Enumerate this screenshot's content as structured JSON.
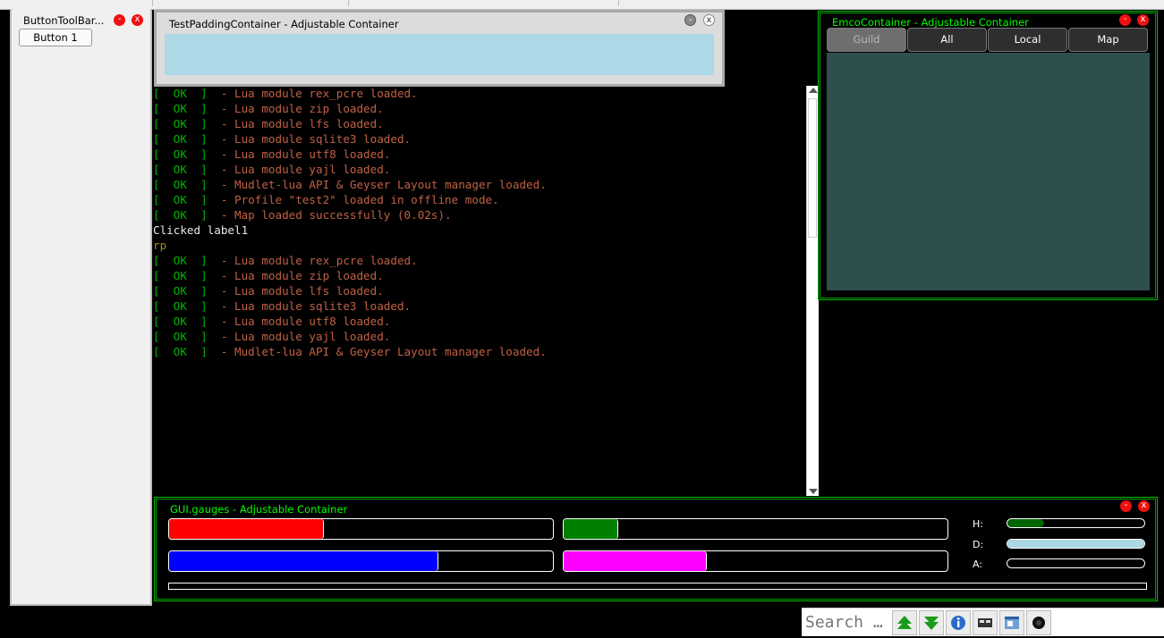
{
  "toolbar": {
    "title": "ButtonToolBar...",
    "button1": "Button 1"
  },
  "padding_container": {
    "title": "TestPaddingContainer - Adjustable Container"
  },
  "console": {
    "lines": [
      {
        "ok": "[  OK  ]",
        "msg": "  - Lua module rex_pcre loaded."
      },
      {
        "ok": "[  OK  ]",
        "msg": "  - Lua module zip loaded."
      },
      {
        "ok": "[  OK  ]",
        "msg": "  - Lua module lfs loaded."
      },
      {
        "ok": "[  OK  ]",
        "msg": "  - Lua module sqlite3 loaded."
      },
      {
        "ok": "[  OK  ]",
        "msg": "  - Lua module utf8 loaded."
      },
      {
        "ok": "[  OK  ]",
        "msg": "  - Lua module yajl loaded."
      },
      {
        "ok": "[  OK  ]",
        "msg": "  - Mudlet-lua API & Geyser Layout manager loaded."
      },
      {
        "ok": "[  OK  ]",
        "msg": "  - Profile \"test2\" loaded in offline mode."
      },
      {
        "ok": "[  OK  ]",
        "msg": "  - Map loaded successfully (0.02s)."
      },
      {
        "plain": "Clicked label1"
      },
      {
        "rp": "rp"
      },
      {
        "ok": "[  OK  ]",
        "msg": "  - Lua module rex_pcre loaded."
      },
      {
        "ok": "[  OK  ]",
        "msg": "  - Lua module zip loaded."
      },
      {
        "ok": "[  OK  ]",
        "msg": "  - Lua module lfs loaded."
      },
      {
        "ok": "[  OK  ]",
        "msg": "  - Lua module sqlite3 loaded."
      },
      {
        "ok": "[  OK  ]",
        "msg": "  - Lua module utf8 loaded."
      },
      {
        "ok": "[  OK  ]",
        "msg": "  - Lua module yajl loaded."
      },
      {
        "ok": "[  OK  ]",
        "msg": "  - Mudlet-lua API & Geyser Layout manager loaded."
      }
    ]
  },
  "emco": {
    "title": "EmcoContainer - Adjustable Container",
    "tabs": [
      "Guild",
      "All",
      "Local",
      "Map"
    ],
    "active_tab": "Guild"
  },
  "gauges": {
    "title": "GUI.gauges - Adjustable Container",
    "bars": [
      {
        "color": "#ff0000",
        "fraction": 0.4
      },
      {
        "color": "#008000",
        "fraction": 0.14
      },
      {
        "color": "#0000ff",
        "fraction": 0.7
      },
      {
        "color": "#ff00ff",
        "fraction": 0.37
      }
    ],
    "small": [
      {
        "label": "H:",
        "color": "#006400",
        "fraction": 0.27
      },
      {
        "label": "D:",
        "color": "#add8e6",
        "fraction": 1.0
      },
      {
        "label": "A:",
        "color": "#000000",
        "fraction": 0.0
      }
    ]
  },
  "window_buttons": {
    "minimize": "-",
    "close": "x"
  },
  "bottombar": {
    "search_placeholder": "Search …",
    "icons": [
      "arrow-up-icon",
      "arrow-down-icon",
      "info-icon",
      "network-icon",
      "map-window-icon",
      "mudlet-icon"
    ]
  },
  "colors": {
    "ok": "#00b400",
    "message": "#c06045",
    "emco_body": "#2f4f4f",
    "padding_body": "#add8e6",
    "container_title": "#00ff00"
  }
}
